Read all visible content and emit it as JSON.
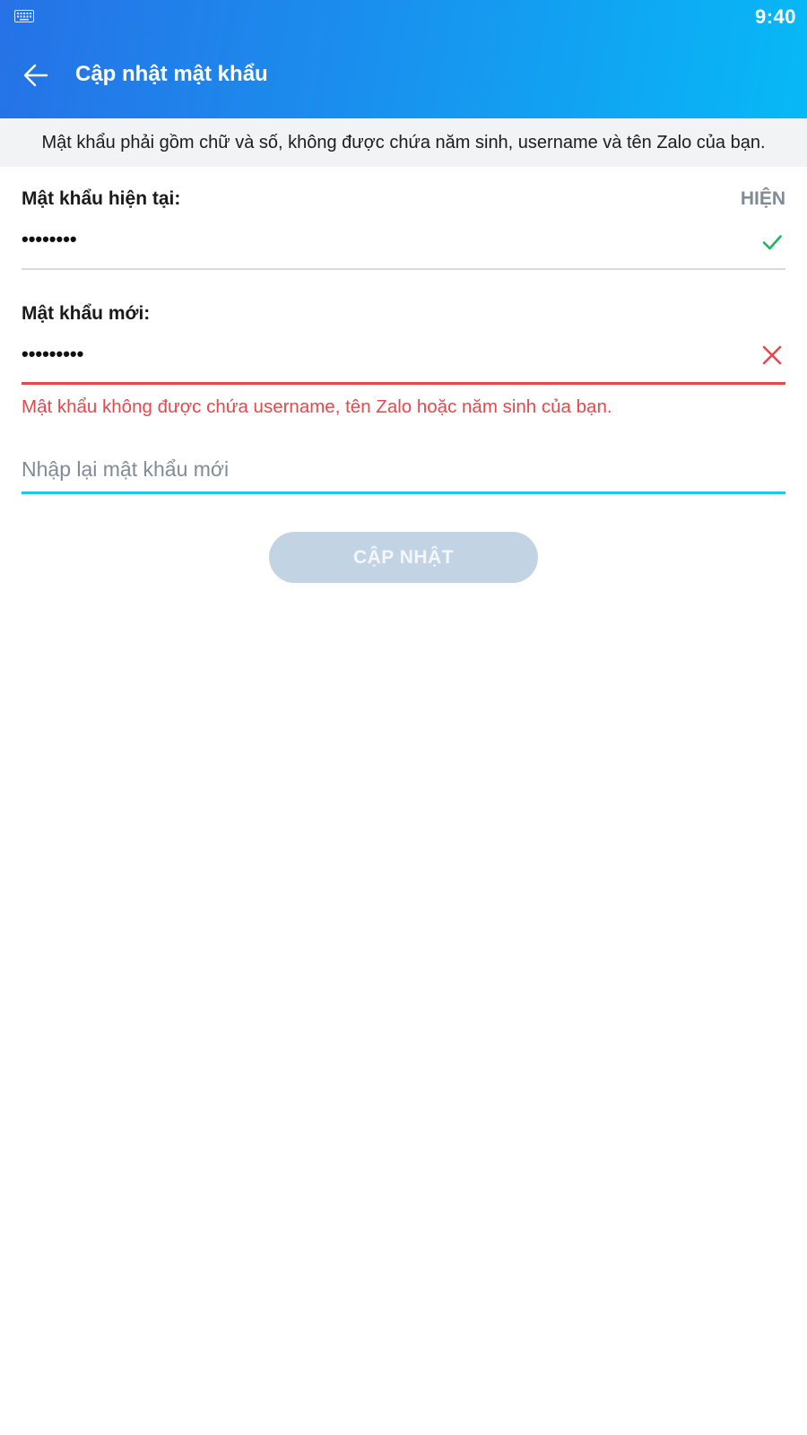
{
  "status_bar": {
    "time": "9:40",
    "left_icon": "keyboard-icon"
  },
  "app_bar": {
    "title": "Cập nhật mật khẩu",
    "back_icon": "arrow-left-icon"
  },
  "hint": "Mật khẩu phải gồm chữ và số, không được chứa năm sinh, username và tên Zalo của bạn.",
  "current_password": {
    "label": "Mật khẩu hiện tại:",
    "show_label": "HIỆN",
    "value": "••••••••",
    "status_icon": "check-icon",
    "status_color": "#1bb85a"
  },
  "new_password": {
    "label": "Mật khẩu mới:",
    "value": "•••••••••",
    "status_icon": "close-icon",
    "status_color": "#e5484d",
    "error": "Mật khẩu không được chứa username, tên Zalo hoặc năm sinh của bạn."
  },
  "confirm_password": {
    "placeholder": "Nhập lại mật khẩu mới",
    "value": "",
    "focus_color": "#1ec8e6"
  },
  "submit": {
    "label": "CẬP NHẬT",
    "enabled": false
  },
  "colors": {
    "header_gradient_start": "#2672e6",
    "header_gradient_end": "#07b9f6",
    "error": "#e5484d",
    "success": "#1bb85a",
    "muted": "#808b96"
  }
}
